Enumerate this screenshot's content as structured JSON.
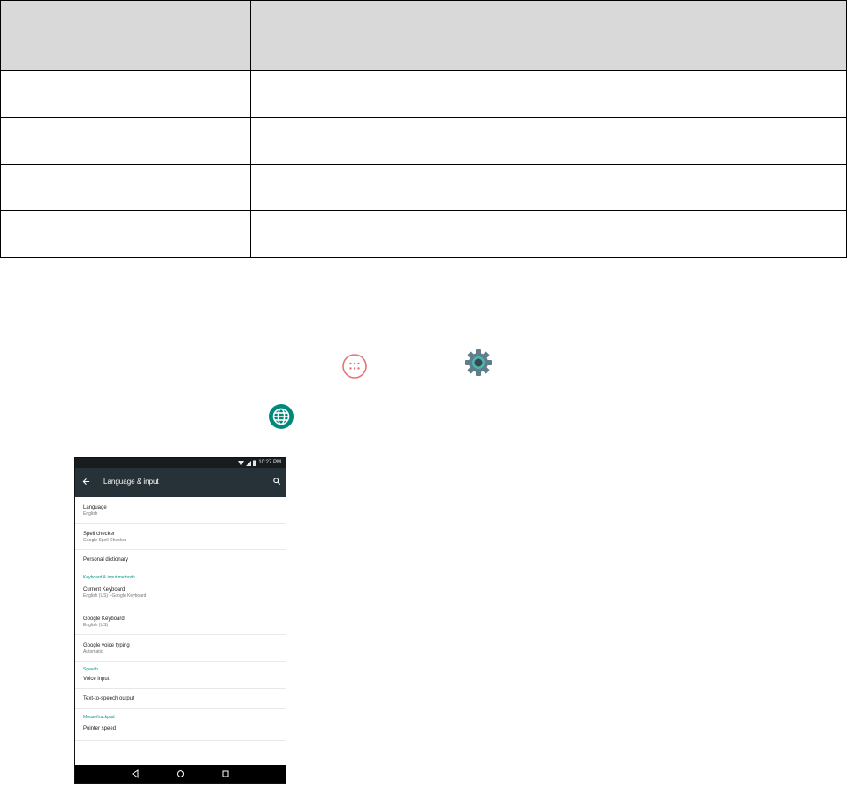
{
  "table": {
    "header": [
      "",
      ""
    ],
    "rows": [
      [
        "",
        ""
      ],
      [
        "",
        ""
      ],
      [
        "",
        ""
      ],
      [
        "",
        ""
      ]
    ]
  },
  "phone": {
    "status_time": "10:27 PM",
    "app_title": "Language & input",
    "items": [
      {
        "title": "Language",
        "sub": "English"
      },
      {
        "title": "Spell checker",
        "sub": "Google Spell Checker"
      },
      {
        "title": "Personal dictionary"
      },
      {
        "category": "Keyboard & input methods"
      },
      {
        "title": "Current Keyboard",
        "sub": "English (US) - Google Keyboard"
      },
      {
        "title": "Google Keyboard",
        "sub": "English (US)"
      },
      {
        "title": "Google voice typing",
        "sub": "Automatic"
      },
      {
        "category": "Speech"
      },
      {
        "title": "Voice input"
      },
      {
        "title": "Text-to-speech output"
      },
      {
        "category": "Mouse/trackpad"
      },
      {
        "title": "Pointer speed"
      }
    ]
  },
  "colors": {
    "table_header_bg": "#d9d9d9",
    "app_bar": "#263238",
    "category_text": "#009688",
    "apps_icon": "#e57373",
    "settings_icon": "#607d8b",
    "globe_icon": "#00897b"
  },
  "icons": [
    "apps-icon",
    "settings-icon",
    "globe-icon",
    "back-arrow-icon",
    "search-icon",
    "nav-back-icon",
    "nav-home-icon",
    "nav-recents-icon"
  ]
}
